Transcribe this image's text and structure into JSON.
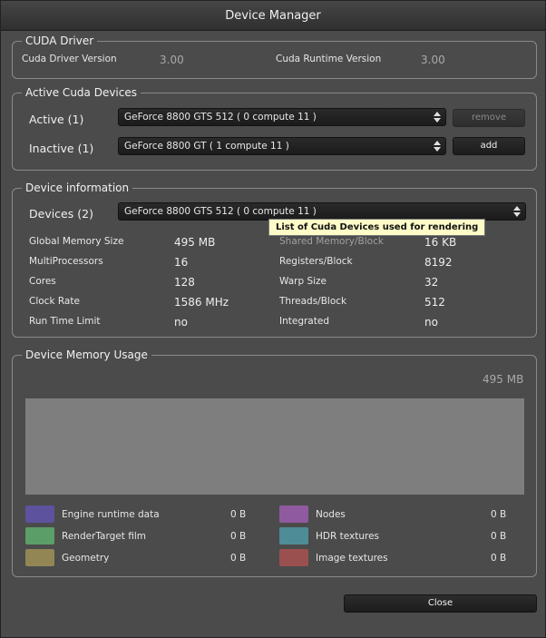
{
  "window": {
    "title": "Device Manager"
  },
  "cuda_driver": {
    "title": "CUDA Driver",
    "driver_label": "Cuda Driver Version",
    "driver_value": "3.00",
    "runtime_label": "Cuda Runtime Version",
    "runtime_value": "3.00"
  },
  "active_devices": {
    "title": "Active Cuda Devices",
    "active_label": "Active (1)",
    "active_selected": "GeForce 8800 GTS 512 ( 0 compute 11 )",
    "remove_label": "remove",
    "inactive_label": "Inactive (1)",
    "inactive_selected": "GeForce 8800 GT ( 1 compute 11 )",
    "add_label": "add"
  },
  "device_info": {
    "title": "Device information",
    "devices_label": "Devices (2)",
    "devices_selected": "GeForce 8800 GTS 512 ( 0 compute 11 )",
    "tooltip": "List of Cuda Devices used for rendering",
    "left": [
      {
        "label": "Global Memory Size",
        "value": "495 MB"
      },
      {
        "label": "MultiProcessors",
        "value": "16"
      },
      {
        "label": "Cores",
        "value": "128"
      },
      {
        "label": "Clock Rate",
        "value": "1586 MHz"
      },
      {
        "label": "Run Time Limit",
        "value": "no"
      }
    ],
    "right": [
      {
        "label": "Shared Memory/Block",
        "value": "16 KB"
      },
      {
        "label": "Registers/Block",
        "value": "8192"
      },
      {
        "label": "Warp Size",
        "value": "32"
      },
      {
        "label": "Threads/Block",
        "value": "512"
      },
      {
        "label": "Integrated",
        "value": "no"
      }
    ]
  },
  "memory_usage": {
    "title": "Device Memory Usage",
    "total": "495 MB",
    "legend": [
      {
        "label": "Engine runtime data",
        "value": "0 B",
        "color": "#5d529e"
      },
      {
        "label": "Nodes",
        "value": "0 B",
        "color": "#8f5aa0"
      },
      {
        "label": "RenderTarget film",
        "value": "0 B",
        "color": "#5c9e67"
      },
      {
        "label": "HDR textures",
        "value": "0 B",
        "color": "#4e8c97"
      },
      {
        "label": "Geometry",
        "value": "0 B",
        "color": "#918654"
      },
      {
        "label": "Image textures",
        "value": "0 B",
        "color": "#9b5050"
      }
    ]
  },
  "footer": {
    "close_label": "Close"
  },
  "icons": {
    "combo_arrow": "up-down-arrows-icon"
  }
}
